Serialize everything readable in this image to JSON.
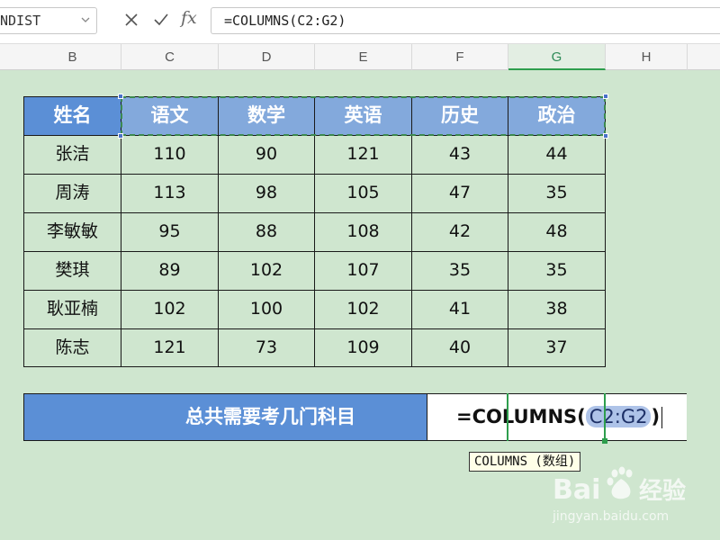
{
  "formula_bar": {
    "name_box": "NDIST",
    "cancel_icon": "close-icon",
    "confirm_icon": "check-icon",
    "fx_label": "fx",
    "formula": "=COLUMNS(C2:G2)"
  },
  "column_headers": [
    "B",
    "C",
    "D",
    "E",
    "F",
    "G",
    "H"
  ],
  "selected_column": "G",
  "table": {
    "headers": [
      "姓名",
      "语文",
      "数学",
      "英语",
      "历史",
      "政治"
    ],
    "rows": [
      [
        "张洁",
        "110",
        "90",
        "121",
        "43",
        "44"
      ],
      [
        "周涛",
        "113",
        "98",
        "105",
        "47",
        "35"
      ],
      [
        "李敏敏",
        "95",
        "88",
        "108",
        "42",
        "48"
      ],
      [
        "樊琪",
        "89",
        "102",
        "107",
        "35",
        "35"
      ],
      [
        "耿亚楠",
        "102",
        "100",
        "102",
        "41",
        "38"
      ],
      [
        "陈志",
        "121",
        "73",
        "109",
        "40",
        "37"
      ]
    ]
  },
  "summary": {
    "label": "总共需要考几门科目",
    "formula_prefix": "=COLUMNS(",
    "formula_ref": "C2:G2",
    "formula_suffix": ")"
  },
  "tooltip": "COLUMNS (数组)",
  "watermark": {
    "brand": "Bai",
    "brand_cn": "经验",
    "url": "jingyan.baidu.com"
  },
  "colors": {
    "sheet_background": "#cfe6cf",
    "header_blue": "#5b8fd6",
    "selected_header_blue": "#83a9dc",
    "selection_green": "#2e9e4d"
  }
}
